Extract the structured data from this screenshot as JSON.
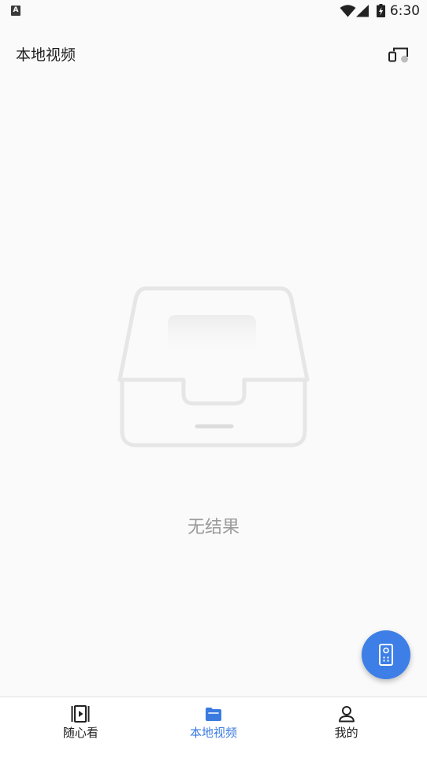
{
  "theme": {
    "background": "#fafafa",
    "accent": "#3b7be0",
    "fab": "#3d7fe6",
    "text": "#222222",
    "muted": "#9b9b9b"
  },
  "status_bar": {
    "notification_glyph": "A",
    "notification_icon": "a-notification-icon",
    "icons": [
      "wifi-icon",
      "signal-icon",
      "battery-charging-icon"
    ],
    "time": "6:30"
  },
  "header": {
    "title": "本地视频",
    "action_icon": "cast-icon"
  },
  "empty_state": {
    "illustration": "empty-tray-icon",
    "message": "无结果"
  },
  "fab": {
    "icon": "remote-control-icon"
  },
  "bottom_nav": {
    "items": [
      {
        "label": "随心看",
        "icon": "video-play-icon",
        "active": false
      },
      {
        "label": "本地视频",
        "icon": "folder-icon",
        "active": true
      },
      {
        "label": "我的",
        "icon": "person-icon",
        "active": false
      }
    ]
  }
}
